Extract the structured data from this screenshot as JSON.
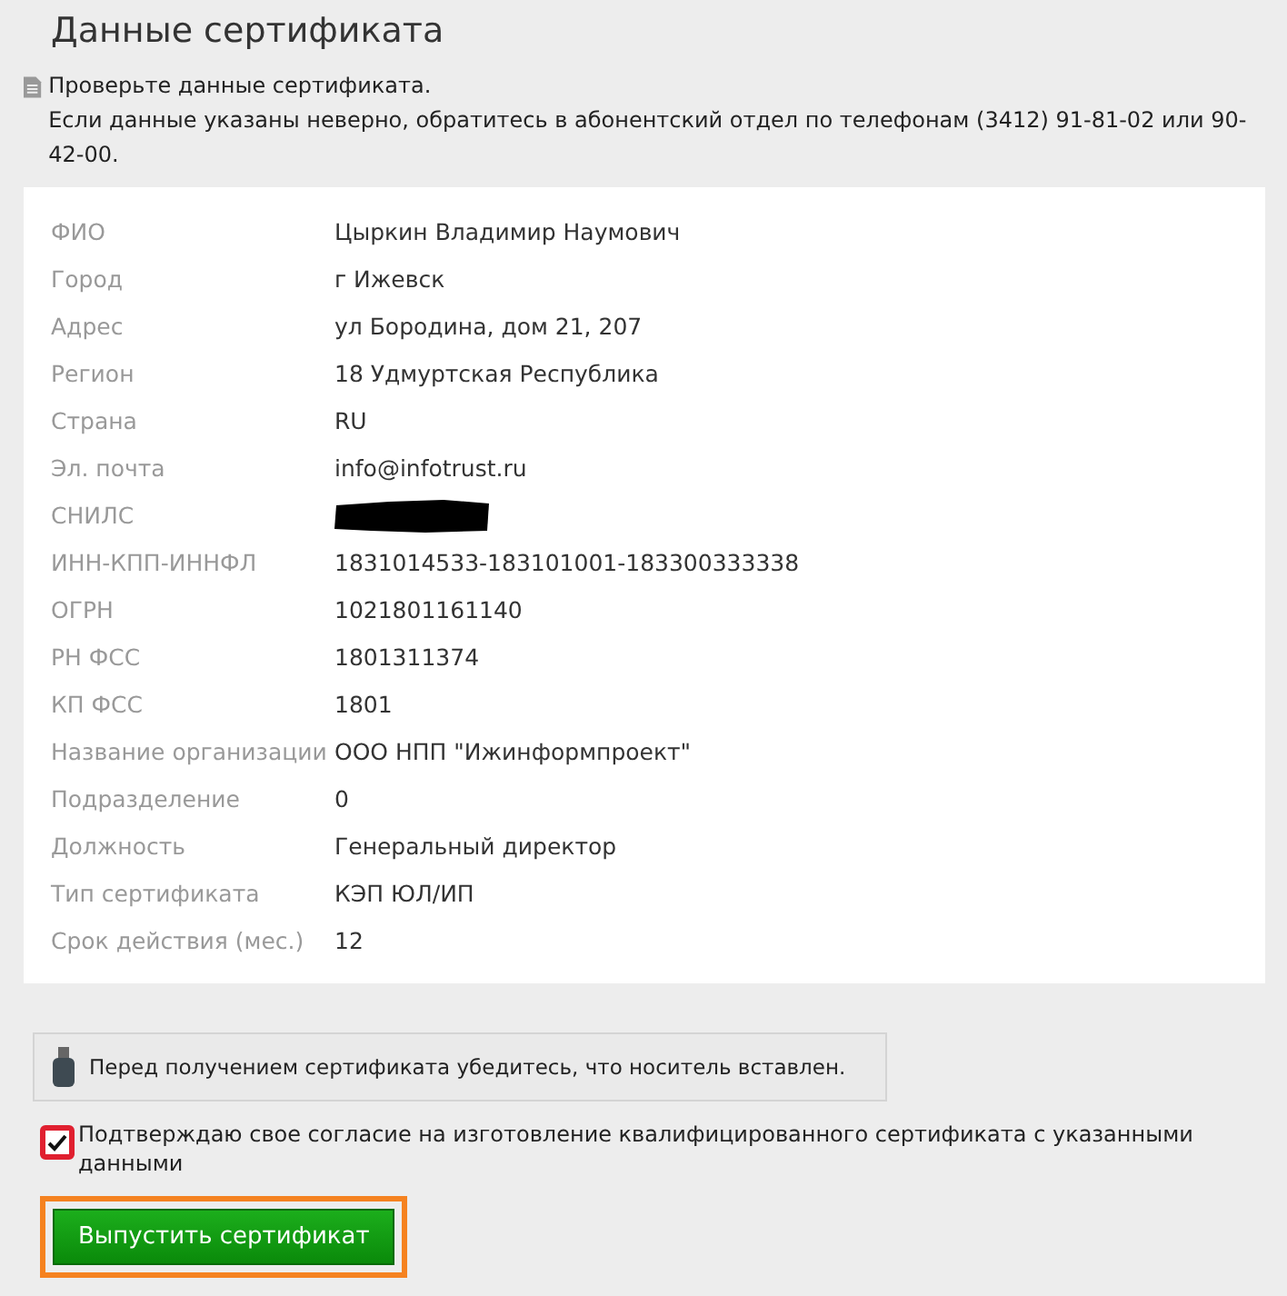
{
  "title": "Данные сертификата",
  "notice": {
    "lines": [
      "Проверьте данные сертификата.",
      "Если данные указаны неверно, обратитесь в абонентский отдел по телефонам (3412) 91-81-02 или 90-42-00."
    ]
  },
  "fields": [
    {
      "label": "ФИО",
      "kind": "text",
      "value": "Цыркин Владимир Наумович"
    },
    {
      "label": "Город",
      "kind": "text",
      "value": "г Ижевск"
    },
    {
      "label": "Адрес",
      "kind": "text",
      "value": "ул Бородина, дом 21, 207"
    },
    {
      "label": "Регион",
      "kind": "text",
      "value": "18 Удмуртская Республика"
    },
    {
      "label": "Страна",
      "kind": "text",
      "value": "RU"
    },
    {
      "label": "Эл. почта",
      "kind": "text",
      "value": "info@infotrust.ru"
    },
    {
      "label": "СНИЛС",
      "kind": "redacted"
    },
    {
      "label": "ИНН-КПП-ИННФЛ",
      "kind": "text",
      "value": "1831014533-183101001-183300333338"
    },
    {
      "label": "ОГРН",
      "kind": "text",
      "value": "1021801161140"
    },
    {
      "label": "РН ФСС",
      "kind": "text",
      "value": "1801311374"
    },
    {
      "label": "КП ФСС",
      "kind": "text",
      "value": "1801"
    },
    {
      "label": "Название организации",
      "kind": "text",
      "value": "ООО НПП \"Ижинформпроект\""
    },
    {
      "label": "Подразделение",
      "kind": "text",
      "value": "0"
    },
    {
      "label": "Должность",
      "kind": "text",
      "value": "Генеральный директор"
    },
    {
      "label": "Тип сертификата",
      "kind": "text",
      "value": "КЭП ЮЛ/ИП"
    },
    {
      "label": "Срок действия (мес.)",
      "kind": "text",
      "value": "12"
    }
  ],
  "usb_notice": "Перед получением сертификата убедитесь, что носитель вставлен.",
  "consent": {
    "label": "Подтверждаю свое согласие на изготовление квалифицированного сертификата с указанными данными",
    "checked": true,
    "highlighted": true
  },
  "submit": {
    "label": "Выпустить сертификат",
    "highlighted": true
  }
}
